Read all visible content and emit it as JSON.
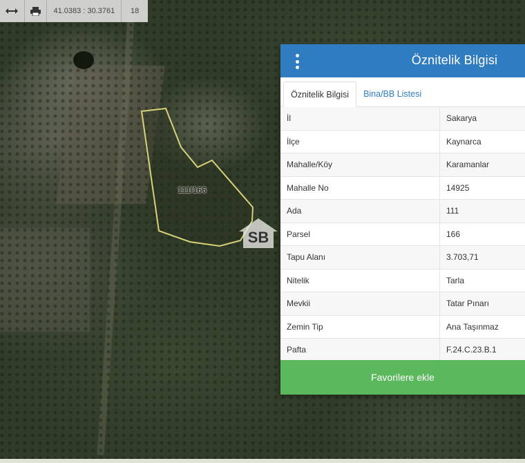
{
  "toolbar": {
    "measure_icon": "horizontal-arrows-icon",
    "print_icon": "printer-icon",
    "coordinates": "41.0383 : 30.3761",
    "zoom": "18"
  },
  "map": {
    "parcel_label": "111/166",
    "parcel_outline_color": "#d8d27a",
    "watermark_icon": "house-logo-icon"
  },
  "panel": {
    "title": "Öznitelik Bilgisi",
    "header_color": "#2f7cc1",
    "tabs": [
      {
        "label": "Öznitelik Bilgisi",
        "active": true
      },
      {
        "label": "Bina/BB Listesi",
        "active": false
      }
    ],
    "rows": [
      {
        "key": "İl",
        "value": "Sakarya"
      },
      {
        "key": "İlçe",
        "value": "Kaynarca"
      },
      {
        "key": "Mahalle/Köy",
        "value": "Karamanlar"
      },
      {
        "key": "Mahalle No",
        "value": "14925"
      },
      {
        "key": "Ada",
        "value": "111"
      },
      {
        "key": "Parsel",
        "value": "166"
      },
      {
        "key": "Tapu Alanı",
        "value": "3.703,71"
      },
      {
        "key": "Nitelik",
        "value": "Tarla"
      },
      {
        "key": "Mevkii",
        "value": "Tatar Pınarı"
      },
      {
        "key": "Zemin Tip",
        "value": "Ana Taşınmaz"
      },
      {
        "key": "Pafta",
        "value": "F.24.C.23.B.1"
      }
    ],
    "favorite_button": "Favorilere ekle",
    "favorite_color": "#5cb85c"
  }
}
